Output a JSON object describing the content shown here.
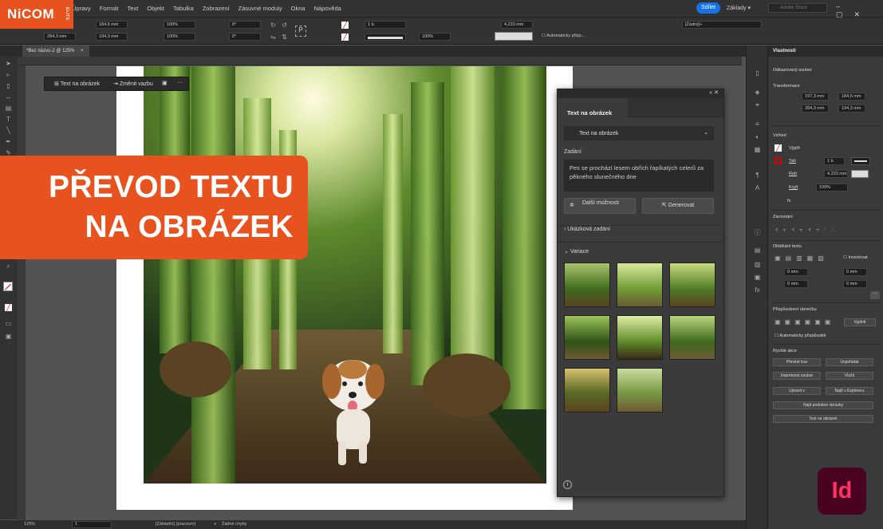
{
  "logo": {
    "text": "NiCOM",
    "sub": "ELITE"
  },
  "menu": [
    "Úpravy",
    "Formát",
    "Text",
    "Objekt",
    "Tabulka",
    "Zobrazení",
    "Zásuvné moduly",
    "Okna",
    "Nápověda"
  ],
  "topbar": {
    "share": "Sdílet",
    "workspace": "Základy",
    "search_placeholder": "Adobe Stock"
  },
  "control": {
    "x": "197,3 mm",
    "y": "284,3 mm",
    "w": "184,6 mm",
    "h": "194,3 mm",
    "sx": "100%",
    "sy": "100%",
    "angle": "0°",
    "shear": "0°",
    "stroke": "1 b.",
    "size": "4,233 mm",
    "zoom": "100%",
    "auto_fit": "Automaticky přizp...",
    "style": "[Žádný]+"
  },
  "doc_tab": "*Bez názvu-2 @ 125%",
  "context_bar": {
    "text_to_image": "Text na obrázek",
    "relink": "Změnit vazbu"
  },
  "banner": {
    "line1": "PŘEVOD TEXTU",
    "line2": "NA OBRÁZEK"
  },
  "panel": {
    "title": "Text na obrázek",
    "dropdown": "Text na obrázek",
    "prompt_label": "Zadání",
    "prompt": "Pes se prochází lesem obřích řapíkatých celerů za pěkného slunečného dne",
    "more_options": "Další možnosti",
    "generate": "Generovat",
    "sample_prompts": "Ukázková zadání",
    "variations": "Variace"
  },
  "properties": {
    "title": "Vlastnosti",
    "subtitle": "Odkazovaný soubor",
    "transform": "Transformace",
    "x": "197,3 mm",
    "y": "284,3 mm",
    "w": "184,6 mm",
    "h": "194,3 mm",
    "appearance": "Vzhled",
    "fill": "Výplň",
    "stroke": "Tah",
    "stroke_w": "1 b.",
    "effects": "Roh",
    "corner": "4,233 mm",
    "opacity_label": "Krytí",
    "opacity": "100%",
    "align": "Zarovnání",
    "wrap": "Obtékání textu",
    "invert": "Invertovat",
    "wrap_vals": [
      "0 mm",
      "0 mm",
      "0 mm",
      "0 mm"
    ],
    "frame_fit": "Přizpůsobení rámečku",
    "fill_btn": "Vyplnit",
    "auto_fit": "Automaticky přizpůsobit",
    "quick": "Rychlé akce",
    "actions": [
      "Převést tvar",
      "Uspořádat",
      "Importovat soubor",
      "Vložit",
      "Upravit v",
      "Najít v Exploreru",
      "Najít podobné obrázky",
      "Text na obrázek"
    ]
  },
  "status": {
    "zoom": "125%",
    "page": "1",
    "preflight": "[Základní] (pracovní)",
    "errors": "Žádné chyby"
  },
  "app_logo": "Id"
}
